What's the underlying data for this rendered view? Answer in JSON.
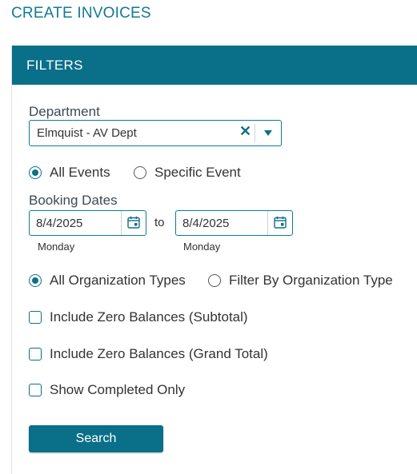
{
  "page": {
    "title": "CREATE INVOICES"
  },
  "filters": {
    "header": "FILTERS",
    "department": {
      "label": "Department",
      "value": "Elmquist - AV Dept"
    },
    "event_scope": {
      "options": [
        "All Events",
        "Specific Event"
      ],
      "selected": "All Events"
    },
    "booking_dates": {
      "label": "Booking Dates",
      "from": "8/4/2025",
      "from_day": "Monday",
      "to_label": "to",
      "to": "8/4/2025",
      "to_day": "Monday"
    },
    "organization": {
      "options": [
        "All Organization Types",
        "Filter By Organization Type"
      ],
      "selected": "All Organization Types"
    },
    "checkboxes": [
      {
        "label": "Include Zero Balances (Subtotal)",
        "checked": false
      },
      {
        "label": "Include Zero Balances (Grand Total)",
        "checked": false
      },
      {
        "label": "Show Completed Only",
        "checked": false
      }
    ],
    "search_label": "Search"
  },
  "colors": {
    "accent": "#0a6f89",
    "title": "#137a96"
  }
}
